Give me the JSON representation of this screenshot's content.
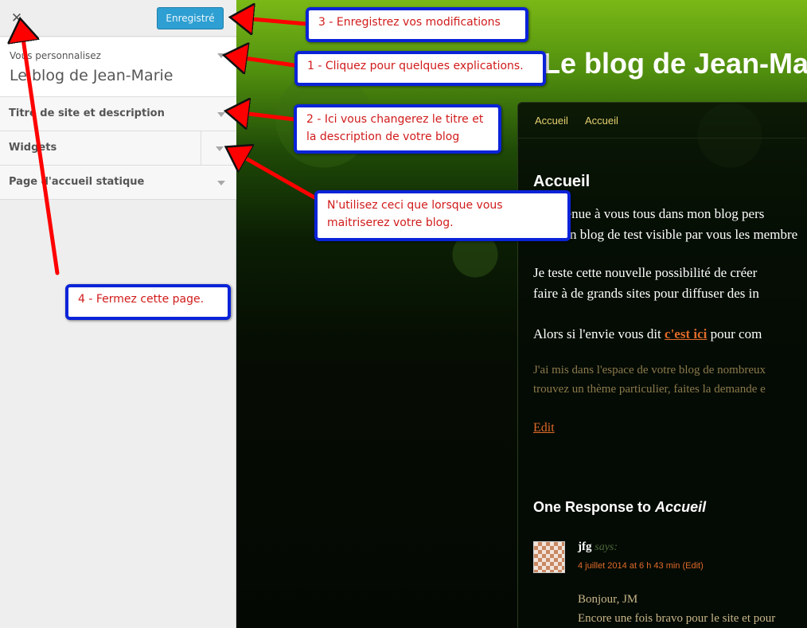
{
  "customizer": {
    "close_icon": "close-icon",
    "save_label": "Enregistré",
    "info": {
      "pre_label": "Vous personnalisez",
      "blog_name": "Le blog de Jean-Marie"
    },
    "sections": [
      {
        "label": "Titre de site et description"
      },
      {
        "label": "Widgets"
      },
      {
        "label": "Page d'accueil statique"
      }
    ]
  },
  "preview": {
    "site_title": "Le blog de Jean-Marie",
    "nav": [
      "Accueil",
      "Accueil"
    ],
    "page_heading": "Accueil",
    "paragraphs": [
      "Bienvenue à vous tous dans mon blog pers",
      "C'est un blog de test visible par vous les membre",
      "Je teste cette nouvelle possibilité de créer",
      "faire à de grands sites pour diffuser des in",
      "Alors si l'envie vous dit",
      "c'est ici",
      "pour com",
      "J'ai mis dans l'espace de votre blog de nombreux",
      "trouvez un thème particulier, faites la demande e"
    ],
    "edit_label": "Edit",
    "responses_prefix": "One Response to",
    "responses_title": "Accueil",
    "comment": {
      "author": "jfg",
      "says": "says:",
      "date": "4 juillet 2014 at 6 h 43 min (Edit)",
      "lines": [
        "Bonjour, JM",
        "Encore une fois bravo pour le site et pour"
      ]
    }
  },
  "annotations": [
    {
      "text": "3 - Enregistrez vos modifications"
    },
    {
      "text": "1 - Cliquez pour quelques explications."
    },
    {
      "text": "2 - Ici vous changerez le titre et la description de votre blog"
    },
    {
      "text": "N'utilisez ceci que lorsque vous maitriserez votre blog."
    },
    {
      "text": "4 - Fermez cette page."
    }
  ],
  "colors": {
    "annotation_border": "#0a23d8",
    "annotation_text": "#d11b1b",
    "arrow": "#ff0000",
    "save_button": "#2e9fd2",
    "link": "#e06a2a"
  }
}
